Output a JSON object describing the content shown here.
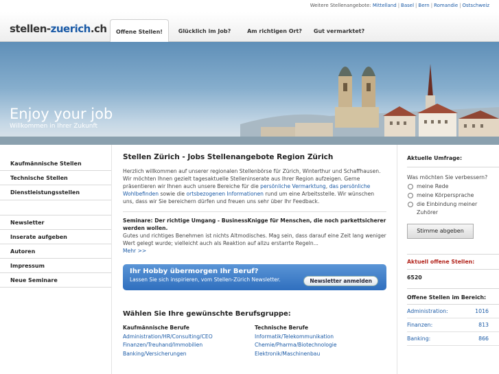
{
  "topbar": {
    "lead": "Weitere Stellenangebote:",
    "links": [
      "Mittelland",
      "Basel",
      "Bern",
      "Romandie",
      "Ostschweiz"
    ]
  },
  "header": {
    "logo_part1": "stellen-",
    "logo_part2": "zuerich",
    "logo_part3": ".ch",
    "tabs": [
      "Offene Stellen!",
      "Glücklich im Job?",
      "Am richtigen Ort?",
      "Gut vermarktet?"
    ]
  },
  "hero": {
    "title": "Enjoy your job",
    "subtitle": "Willkommen in Ihrer Zukunft"
  },
  "sidebar": {
    "group1": [
      "Kaufmännische Stellen",
      "Technische Stellen",
      "Dienstleistungsstellen"
    ],
    "group2": [
      "Newsletter",
      "Inserate aufgeben",
      "Autoren",
      "Impressum",
      "Neue Seminare"
    ]
  },
  "main": {
    "heading": "Stellen Zürich - Jobs Stellenangebote Region Zürich",
    "intro1": "Herzlich willkommen auf unserer regionalen Stellenbörse für Zürich, Winterthur und Schaffhausen. Wir möchten Ihnen gezielt tagesaktuelle Stelleninserate aus Ihrer Region aufzeigen. Gerne präsentieren wir Ihnen auch unsere Bereiche für die ",
    "intro_link1": "persönliche Vermarktung",
    "intro2": ", ",
    "intro_link2": "das persönliche Wohlbefinden",
    "intro3": " sowie die ",
    "intro_link3": "ortsbezogenen Informationen",
    "intro4": " rund um eine Arbeitsstelle. Wir wünschen uns, dass wir Sie bereichern dürfen und freuen uns sehr über Ihr Feedback.",
    "seminar_title": "Seminare: Der richtige Umgang - BusinessKnigge für Menschen, die noch parkettsicherer werden wollen.",
    "seminar_text": "Gutes und richtiges Benehmen ist nichts Altmodisches. Mag sein, dass darauf eine Zeit lang weniger Wert gelegt wurde; vielleicht auch als Reaktion auf allzu erstarrte Regeln...",
    "more": "Mehr >>",
    "banner_title": "Ihr Hobby übermorgen Ihr Beruf?",
    "banner_sub": "Lassen Sie sich inspirieren, vom Stellen-Zürich Newsletter.",
    "banner_button": "Newsletter anmelden",
    "choose_heading": "Wählen Sie Ihre gewünschte Berufsgruppe:",
    "col1": {
      "heading": "Kaufmännische Berufe",
      "links": [
        "Administration/HR/Consulting/CEO",
        "Finanzen/Treuhand/Immobilien",
        "Banking/Versicherungen"
      ]
    },
    "col2": {
      "heading": "Technische Berufe",
      "links": [
        "Informatik/Telekommunikation",
        "Chemie/Pharma/Biotechnologie",
        "Elektronik/Maschinenbau"
      ]
    }
  },
  "right": {
    "poll_heading": "Aktuelle Umfrage:",
    "poll_question": "Was möchten Sie verbessern?",
    "options": [
      "meine Rede",
      "meine Körpersprache",
      "die Einbindung meiner Zuhörer"
    ],
    "vote_button": "Stimme abgeben",
    "current_heading": "Aktuell offene Stellen:",
    "current_count": "6520",
    "areas_heading": "Offene Stellen im Bereich:",
    "areas": [
      {
        "name": "Administration:",
        "count": "1016"
      },
      {
        "name": "Finanzen:",
        "count": "813"
      },
      {
        "name": "Banking:",
        "count": "866"
      }
    ]
  },
  "colors": {
    "accent": "#1a5aa6",
    "highlight": "#b3261e"
  }
}
